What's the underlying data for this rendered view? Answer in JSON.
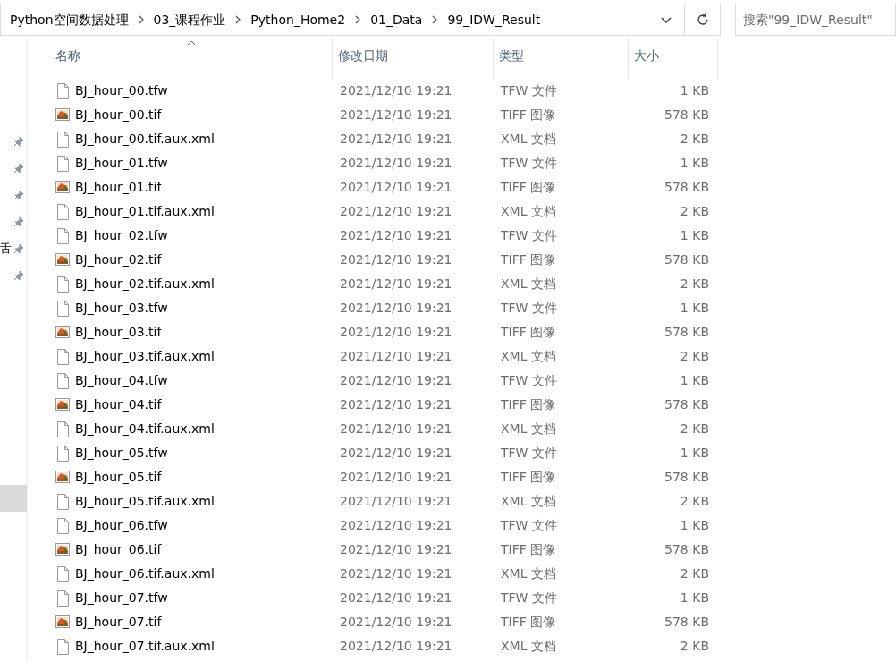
{
  "address_bar": {
    "breadcrumbs": [
      "Python空间数据处理",
      "03_课程作业",
      "Python_Home2",
      "01_Data",
      "99_IDW_Result"
    ]
  },
  "search": {
    "placeholder": "搜索\"99_IDW_Result\""
  },
  "sidebar": {
    "items": [
      {
        "pinned": true,
        "selected": false
      },
      {
        "pinned": true,
        "selected": false
      },
      {
        "pinned": true,
        "selected": false
      },
      {
        "pinned": true,
        "selected": false
      },
      {
        "label": "舌",
        "pinned": true,
        "selected": false
      },
      {
        "pinned": true,
        "selected": false
      },
      {
        "pinned": false,
        "selected": true
      }
    ]
  },
  "table": {
    "columns": [
      {
        "label": "名称",
        "sorted": true
      },
      {
        "label": "修改日期",
        "sorted": false
      },
      {
        "label": "类型",
        "sorted": false
      },
      {
        "label": "大小",
        "sorted": false
      }
    ],
    "rows": [
      {
        "kind": "doc",
        "name": "BJ_hour_00.tfw",
        "date": "2021/12/10 19:21",
        "type": "TFW 文件",
        "size": "1 KB"
      },
      {
        "kind": "image",
        "name": "BJ_hour_00.tif",
        "date": "2021/12/10 19:21",
        "type": "TIFF 图像",
        "size": "578 KB"
      },
      {
        "kind": "doc",
        "name": "BJ_hour_00.tif.aux.xml",
        "date": "2021/12/10 19:21",
        "type": "XML 文档",
        "size": "2 KB"
      },
      {
        "kind": "doc",
        "name": "BJ_hour_01.tfw",
        "date": "2021/12/10 19:21",
        "type": "TFW 文件",
        "size": "1 KB"
      },
      {
        "kind": "image",
        "name": "BJ_hour_01.tif",
        "date": "2021/12/10 19:21",
        "type": "TIFF 图像",
        "size": "578 KB"
      },
      {
        "kind": "doc",
        "name": "BJ_hour_01.tif.aux.xml",
        "date": "2021/12/10 19:21",
        "type": "XML 文档",
        "size": "2 KB"
      },
      {
        "kind": "doc",
        "name": "BJ_hour_02.tfw",
        "date": "2021/12/10 19:21",
        "type": "TFW 文件",
        "size": "1 KB"
      },
      {
        "kind": "image",
        "name": "BJ_hour_02.tif",
        "date": "2021/12/10 19:21",
        "type": "TIFF 图像",
        "size": "578 KB"
      },
      {
        "kind": "doc",
        "name": "BJ_hour_02.tif.aux.xml",
        "date": "2021/12/10 19:21",
        "type": "XML 文档",
        "size": "2 KB"
      },
      {
        "kind": "doc",
        "name": "BJ_hour_03.tfw",
        "date": "2021/12/10 19:21",
        "type": "TFW 文件",
        "size": "1 KB"
      },
      {
        "kind": "image",
        "name": "BJ_hour_03.tif",
        "date": "2021/12/10 19:21",
        "type": "TIFF 图像",
        "size": "578 KB"
      },
      {
        "kind": "doc",
        "name": "BJ_hour_03.tif.aux.xml",
        "date": "2021/12/10 19:21",
        "type": "XML 文档",
        "size": "2 KB"
      },
      {
        "kind": "doc",
        "name": "BJ_hour_04.tfw",
        "date": "2021/12/10 19:21",
        "type": "TFW 文件",
        "size": "1 KB"
      },
      {
        "kind": "image",
        "name": "BJ_hour_04.tif",
        "date": "2021/12/10 19:21",
        "type": "TIFF 图像",
        "size": "578 KB"
      },
      {
        "kind": "doc",
        "name": "BJ_hour_04.tif.aux.xml",
        "date": "2021/12/10 19:21",
        "type": "XML 文档",
        "size": "2 KB"
      },
      {
        "kind": "doc",
        "name": "BJ_hour_05.tfw",
        "date": "2021/12/10 19:21",
        "type": "TFW 文件",
        "size": "1 KB"
      },
      {
        "kind": "image",
        "name": "BJ_hour_05.tif",
        "date": "2021/12/10 19:21",
        "type": "TIFF 图像",
        "size": "578 KB"
      },
      {
        "kind": "doc",
        "name": "BJ_hour_05.tif.aux.xml",
        "date": "2021/12/10 19:21",
        "type": "XML 文档",
        "size": "2 KB"
      },
      {
        "kind": "doc",
        "name": "BJ_hour_06.tfw",
        "date": "2021/12/10 19:21",
        "type": "TFW 文件",
        "size": "1 KB"
      },
      {
        "kind": "image",
        "name": "BJ_hour_06.tif",
        "date": "2021/12/10 19:21",
        "type": "TIFF 图像",
        "size": "578 KB"
      },
      {
        "kind": "doc",
        "name": "BJ_hour_06.tif.aux.xml",
        "date": "2021/12/10 19:21",
        "type": "XML 文档",
        "size": "2 KB"
      },
      {
        "kind": "doc",
        "name": "BJ_hour_07.tfw",
        "date": "2021/12/10 19:21",
        "type": "TFW 文件",
        "size": "1 KB"
      },
      {
        "kind": "image",
        "name": "BJ_hour_07.tif",
        "date": "2021/12/10 19:21",
        "type": "TIFF 图像",
        "size": "578 KB"
      },
      {
        "kind": "doc",
        "name": "BJ_hour_07.tif.aux.xml",
        "date": "2021/12/10 19:21",
        "type": "XML 文档",
        "size": "2 KB"
      }
    ]
  }
}
